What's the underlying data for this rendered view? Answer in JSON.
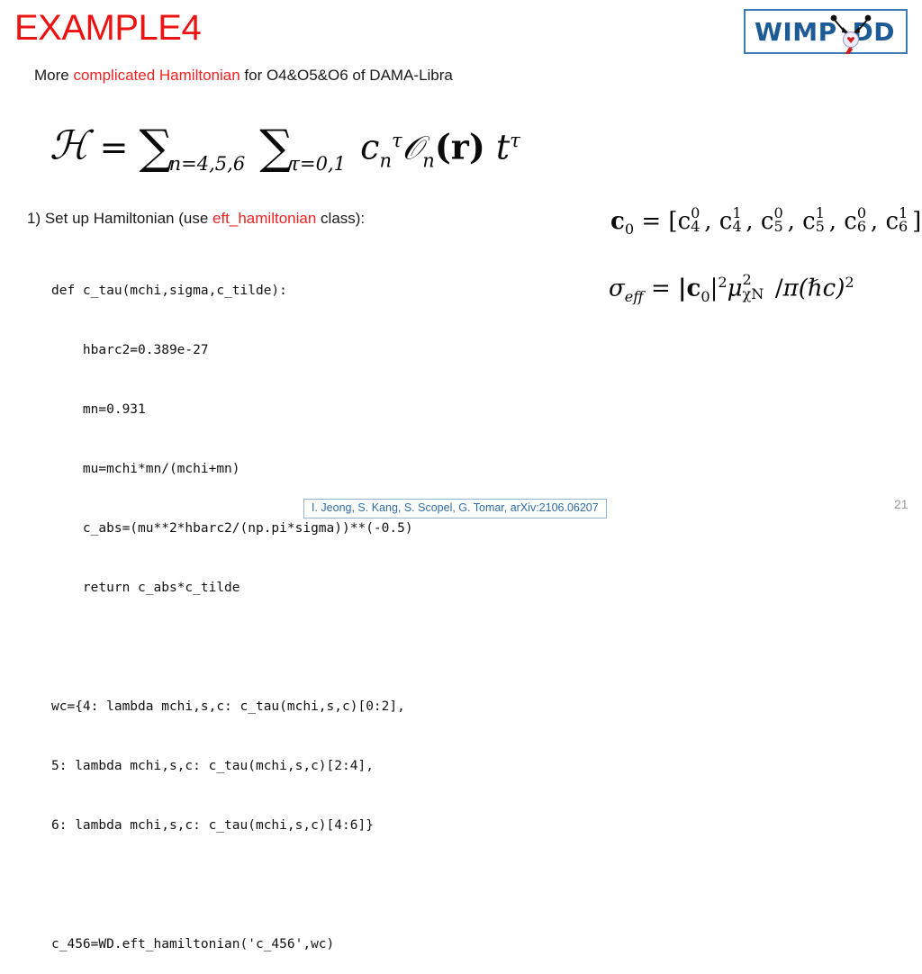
{
  "slide": {
    "title": "EXAMPLE4",
    "subtitle": {
      "part1": "More ",
      "highlight": "complicated Hamiltonian",
      "part2": " for O4&O5&O6 of DAMA-Libra"
    },
    "page_number": "21",
    "title_color": "#ee1111",
    "highlight_color": "#ee2222",
    "citation_color": "#2e6ca3",
    "logo_color": "#1d5b96"
  },
  "logo": {
    "word_left": "WIMP",
    "word_right": "DD",
    "diagram_name": "feynman-scattering-diagram"
  },
  "main_equation": {
    "latex": "\\mathcal{H} = \\sum_{n=4,5,6} \\sum_{\\tau=0,1} c_n^{\\tau} \\mathcal{O}_n(\\mathbf{r}) t^{\\tau}",
    "plain": "H = Sum_{n=4,5,6} Sum_{tau=0,1} c_n^tau O_n(r) t^tau",
    "lhs": "ℋ",
    "equals": "=",
    "sum1_symbol": "∑",
    "sum1_subscript": "n=4,5,6",
    "sum2_symbol": "∑",
    "sum2_subscript": "τ=0,1",
    "coefficient": "c",
    "coefficient_sub": "n",
    "coefficient_sup": "τ",
    "operator": "𝒪",
    "operator_sub": "n",
    "operator_arg": "(r)",
    "isospin": "t",
    "isospin_sup": "τ"
  },
  "step1": {
    "part1": "1) Set up Hamiltonian (use ",
    "highlight": "eft_hamiltonian",
    "part2": " class):"
  },
  "code": {
    "lines": [
      "def c_tau(mchi,sigma,c_tilde):",
      "    hbarc2=0.389e-27",
      "    mn=0.931",
      "    mu=mchi*mn/(mchi+mn)",
      "    c_abs=(mu**2*hbarc2/(np.pi*sigma))**(-0.5)",
      "    return c_abs*c_tilde",
      "",
      "wc={4: lambda mchi,s,c: c_tau(mchi,s,c)[0:2],",
      "5: lambda mchi,s,c: c_tau(mchi,s,c)[2:4],",
      "6: lambda mchi,s,c: c_tau(mchi,s,c)[4:6]}",
      "",
      "c_456=WD.eft_hamiltonian('c_456',wc)"
    ]
  },
  "right_equations": {
    "c0": {
      "latex": "\\mathbf{c}_0 = [\\mathrm{c}_4^0,\\ \\mathrm{c}_4^1,\\ \\mathrm{c}_5^0,\\ \\mathrm{c}_5^1,\\ \\mathrm{c}_6^0,\\ \\mathrm{c}_6^1]",
      "plain": "c_0 = [c_4^0, c_4^1, c_5^0, c_5^1, c_6^0, c_6^1]",
      "lhs": "c",
      "lhs_sub": "0",
      "equals": "=",
      "components": [
        {
          "base": "c",
          "sub": "4",
          "sup": "0"
        },
        {
          "base": "c",
          "sub": "4",
          "sup": "1"
        },
        {
          "base": "c",
          "sub": "5",
          "sup": "0"
        },
        {
          "base": "c",
          "sub": "5",
          "sup": "1"
        },
        {
          "base": "c",
          "sub": "6",
          "sup": "0"
        },
        {
          "base": "c",
          "sub": "6",
          "sup": "1"
        }
      ]
    },
    "sigma_eff": {
      "latex": "\\sigma_{eff} = |\\mathbf{c}_0|^2 \\mu_{\\chi N}^2 / \\pi(\\hbar c)^2",
      "plain": "sigma_eff = |c_0|^2 mu_chiN^2 / pi (hbar c)^2",
      "lhs": "σ",
      "lhs_sub": "eff",
      "equals": "=",
      "rhs_abs": "|c",
      "rhs_abs_sub": "0",
      "rhs_abs_sup": "2",
      "mu": "μ",
      "mu_sub": "χN",
      "mu_sup": "2",
      "divider": "/",
      "pi": "π",
      "hbar_c": "(ℏc)",
      "hbar_c_sup": "2"
    }
  },
  "citation": {
    "text": "I. Jeong, S. Kang, S. Scopel, G. Tomar, arXiv:2106.06207"
  }
}
